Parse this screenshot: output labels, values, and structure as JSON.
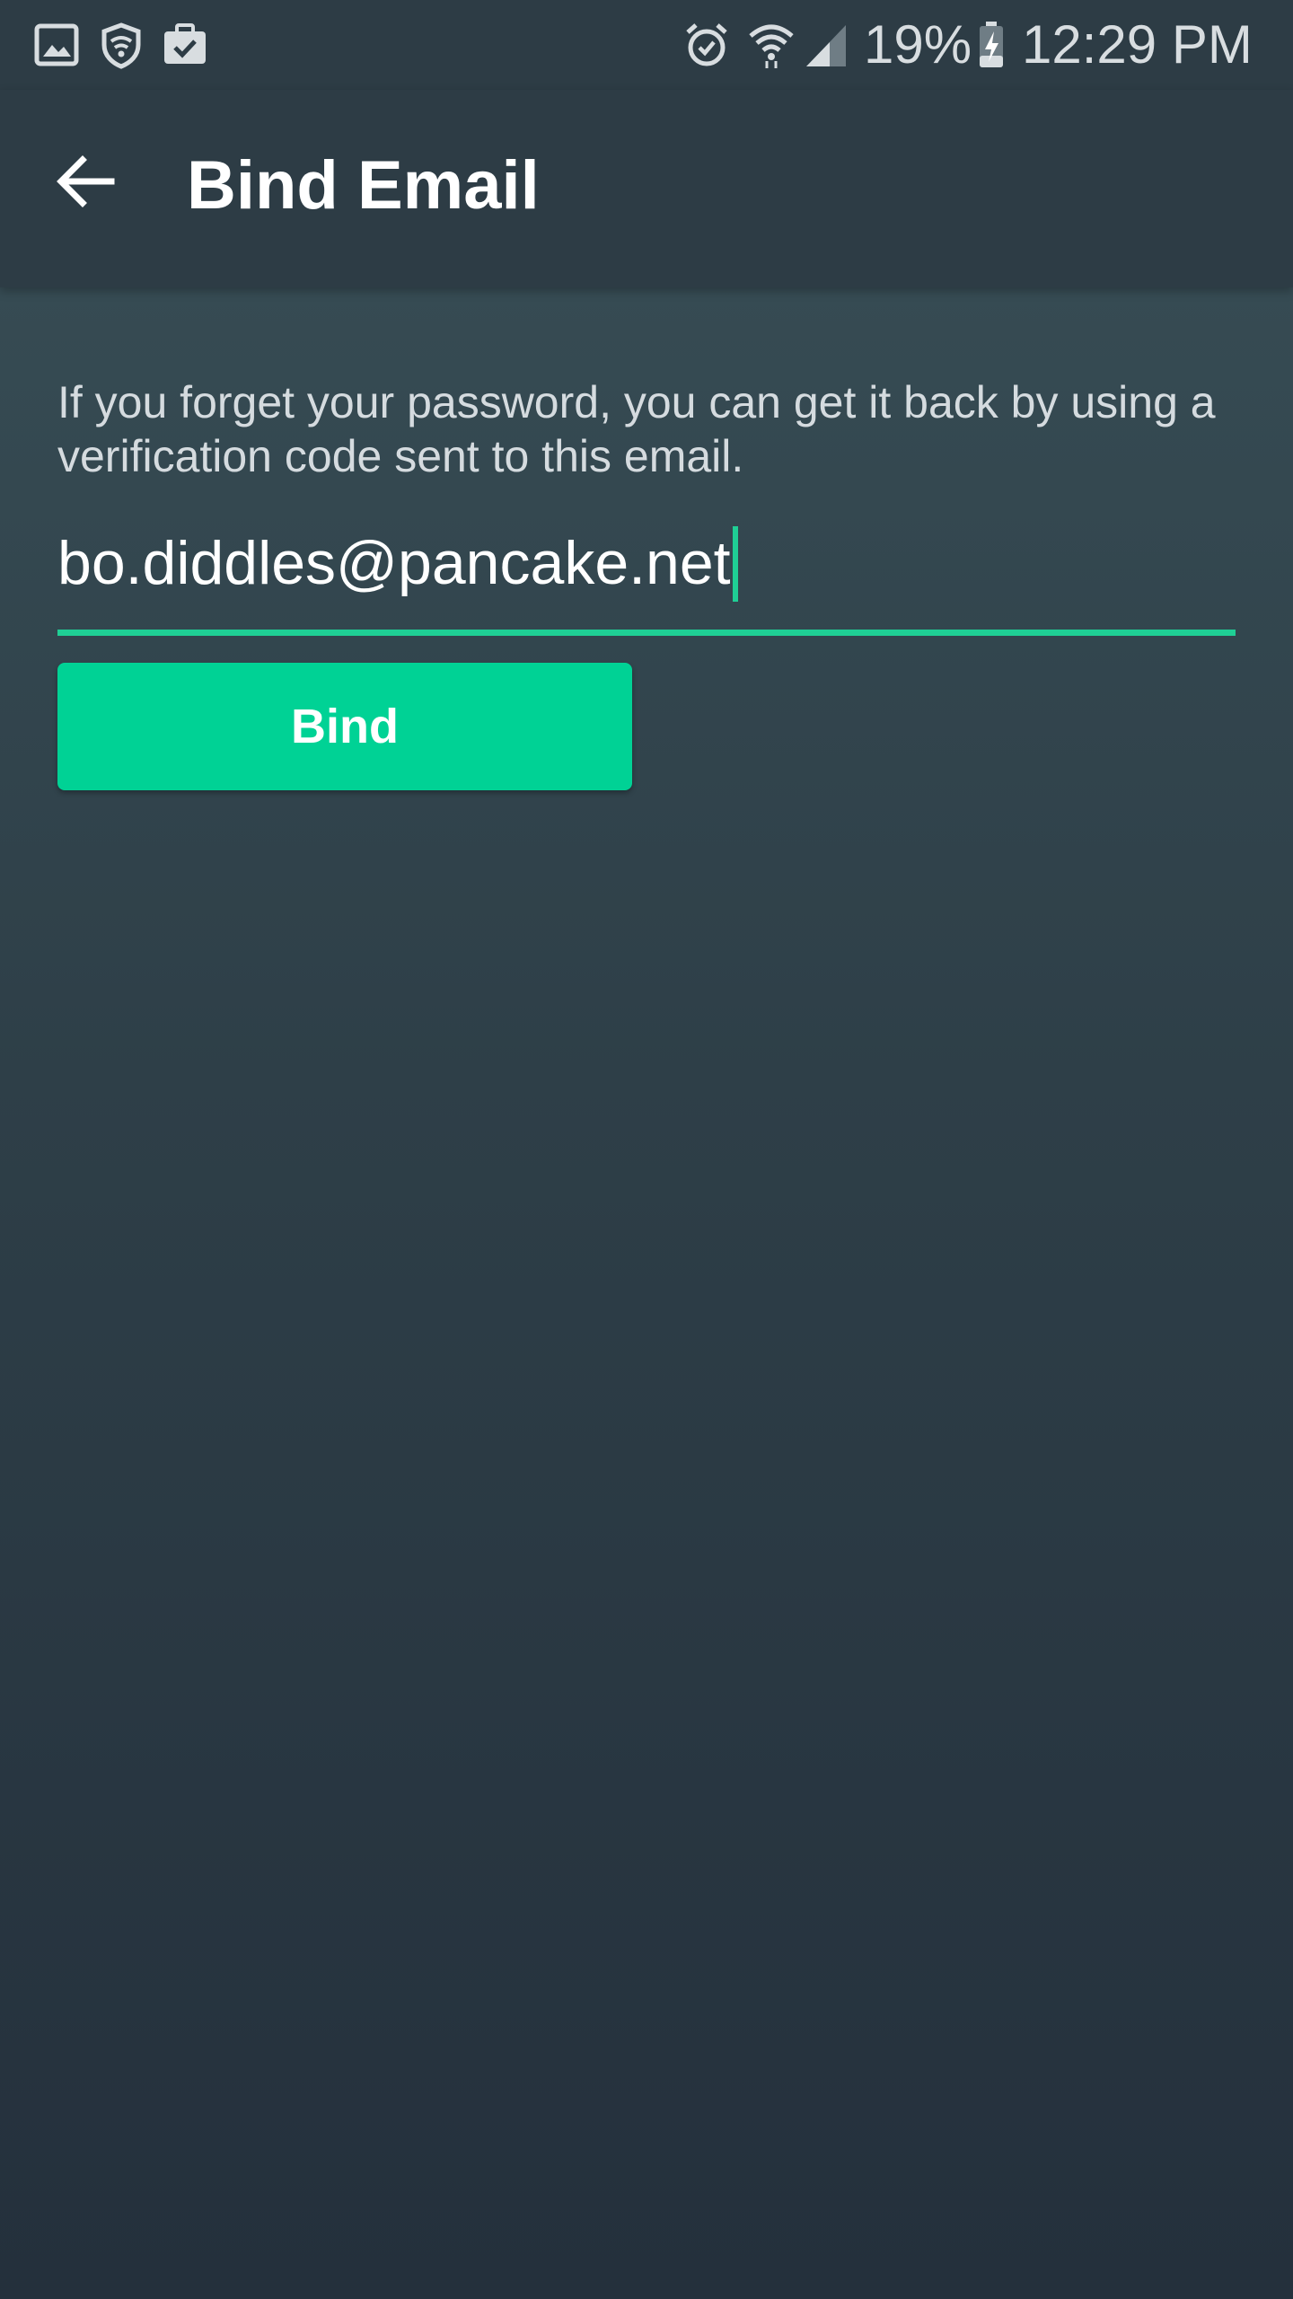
{
  "status_bar": {
    "battery_percent": "19%",
    "time": "12:29 PM",
    "icons": [
      "gallery-icon",
      "vpn-shield-icon",
      "work-briefcase-icon",
      "alarm-icon",
      "wifi-icon",
      "cellular-signal-icon",
      "battery-charging-icon"
    ]
  },
  "toolbar": {
    "title": "Bind Email",
    "back_icon": "arrow-left-icon"
  },
  "main": {
    "description": "If you forget your password, you can get it back by using a verification code sent to this email.",
    "email_value": "bo.diddles@pancake.net",
    "bind_button_label": "Bind"
  },
  "colors": {
    "accent": "#00d295",
    "toolbar": "#2d3c45",
    "text": "#ffffff"
  }
}
